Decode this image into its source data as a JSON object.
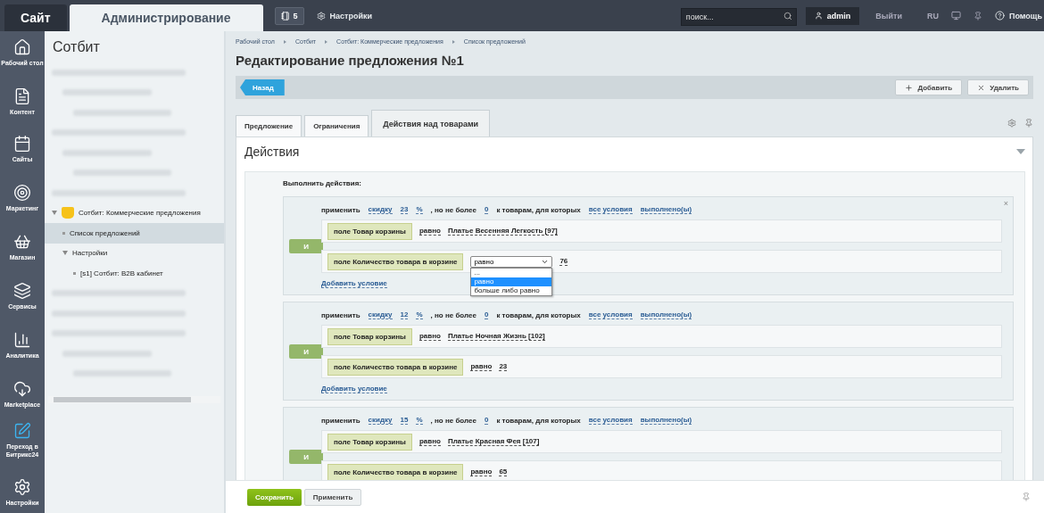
{
  "topbar": {
    "tabs": [
      {
        "label": "Сайт",
        "selected": false
      },
      {
        "label": "Администрирование",
        "selected": true
      }
    ],
    "notifications": "5",
    "settings": "Настройки",
    "search": {
      "placeholder": "поиск..."
    },
    "user": "admin",
    "logout": "Выйти",
    "language": "RU",
    "help": "Помощь"
  },
  "left_menu": [
    {
      "label": "Рабочий стол",
      "kind": "desktop"
    },
    {
      "label": "Контент",
      "kind": "content"
    },
    {
      "label": "Сайты",
      "kind": "sites"
    },
    {
      "label": "Маркетинг",
      "kind": "marketing"
    },
    {
      "label": "Магазин",
      "kind": "shop"
    },
    {
      "label": "Сервисы",
      "kind": "services"
    },
    {
      "label": "Аналитика",
      "kind": "analytics"
    },
    {
      "label": "Marketplace",
      "kind": "marketplace"
    },
    {
      "label": "Переход в Битрикс24",
      "kind": "bitrix24"
    },
    {
      "label": "Настройки",
      "kind": "settings"
    }
  ],
  "tree": {
    "title": "Сотбит",
    "items": [
      {
        "kind": "blurred",
        "children": [
          {
            "kind": "blurred",
            "children": [
              {
                "kind": "blurred"
              }
            ]
          }
        ]
      },
      {
        "kind": "blurred",
        "children": [
          {
            "kind": "blurred",
            "children": [
              {
                "kind": "blurred"
              }
            ]
          }
        ]
      },
      {
        "kind": "blurred"
      },
      {
        "kind": "module",
        "label": "Сотбит: Коммерческие предложения",
        "selected": false,
        "expanded": true,
        "children": [
          {
            "kind": "leaf",
            "label": "Список предложений",
            "selected": true
          },
          {
            "kind": "folder",
            "label": "Настройки",
            "selected": false,
            "expanded": true,
            "children": [
              {
                "kind": "leaf",
                "label": "[s1] Сотбит: B2B кабинет",
                "selected": false
              }
            ]
          }
        ]
      },
      {
        "kind": "blurred"
      },
      {
        "kind": "blurred"
      },
      {
        "kind": "blurred",
        "children": [
          {
            "kind": "blurred",
            "children": [
              {
                "kind": "blurred"
              }
            ]
          }
        ]
      }
    ]
  },
  "breadcrumbs": [
    "Рабочий стол",
    "Сотбит",
    "Сотбит: Коммерческие предложения",
    "Список предложений"
  ],
  "title": "Редактирование предложения №1",
  "toolbar": {
    "back": "Назад",
    "add": "Добавить",
    "delete": "Удалить"
  },
  "tabs": [
    {
      "label": "Предложение",
      "selected": false
    },
    {
      "label": "Ограничения",
      "selected": false
    },
    {
      "label": "Действия над товарами",
      "selected": true
    }
  ],
  "section": {
    "title": "Действия",
    "expanded": true,
    "intro": "Выполнить действия:",
    "blocks": [
      {
        "close": "×",
        "connector": "И",
        "add_condition": "Добавить условие",
        "apply": [
          {
            "kind": "text",
            "text": "применить"
          },
          {
            "kind": "link",
            "text": "скидку"
          },
          {
            "kind": "link",
            "text": "23"
          },
          {
            "kind": "link",
            "text": "%"
          },
          {
            "kind": "text",
            "text": ", но не более"
          },
          {
            "kind": "link",
            "text": "0"
          },
          {
            "kind": "text",
            "text": "к товарам, для которых"
          },
          {
            "kind": "link",
            "text": "все условия"
          },
          {
            "kind": "link",
            "text": "выполнено(ы)"
          }
        ],
        "conditions": [
          {
            "field": "поле Товар корзины",
            "operator": "равно",
            "value": "Платье Весенняя Легкость [97]"
          },
          {
            "field": "поле Количество товара в корзине",
            "value": "76",
            "select": {
              "value": "равно",
              "options": [
                {
                  "label": "...",
                  "selected": false
                },
                {
                  "label": "равно",
                  "selected": true
                },
                {
                  "label": "больше либо равно",
                  "selected": false
                }
              ]
            }
          }
        ]
      },
      {
        "connector": "И",
        "add_condition": "Добавить условие",
        "apply": [
          {
            "kind": "text",
            "text": "применить"
          },
          {
            "kind": "link",
            "text": "скидку"
          },
          {
            "kind": "link",
            "text": "12"
          },
          {
            "kind": "link",
            "text": "%"
          },
          {
            "kind": "text",
            "text": ", но не более"
          },
          {
            "kind": "link",
            "text": "0"
          },
          {
            "kind": "text",
            "text": "к товарам, для которых"
          },
          {
            "kind": "link",
            "text": "все условия"
          },
          {
            "kind": "link",
            "text": "выполнено(ы)"
          }
        ],
        "conditions": [
          {
            "field": "поле Товар корзины",
            "operator": "равно",
            "value": "Платье Ночная Жизнь [102]"
          },
          {
            "field": "поле Количество товара в корзине",
            "operator": "равно",
            "value": "23"
          }
        ]
      },
      {
        "connector": "И",
        "apply": [
          {
            "kind": "text",
            "text": "применить"
          },
          {
            "kind": "link",
            "text": "скидку"
          },
          {
            "kind": "link",
            "text": "15"
          },
          {
            "kind": "link",
            "text": "%"
          },
          {
            "kind": "text",
            "text": ", но не более"
          },
          {
            "kind": "link",
            "text": "0"
          },
          {
            "kind": "text",
            "text": "к товарам, для которых"
          },
          {
            "kind": "link",
            "text": "все условия"
          },
          {
            "kind": "link",
            "text": "выполнено(ы)"
          }
        ],
        "conditions": [
          {
            "field": "поле Товар корзины",
            "operator": "равно",
            "value": "Платье Красная Фея [107]"
          },
          {
            "field": "поле Количество товара в корзине",
            "operator": "равно",
            "value": "65"
          }
        ]
      }
    ]
  },
  "footer": {
    "save": "Сохранить",
    "apply": "Применить"
  }
}
